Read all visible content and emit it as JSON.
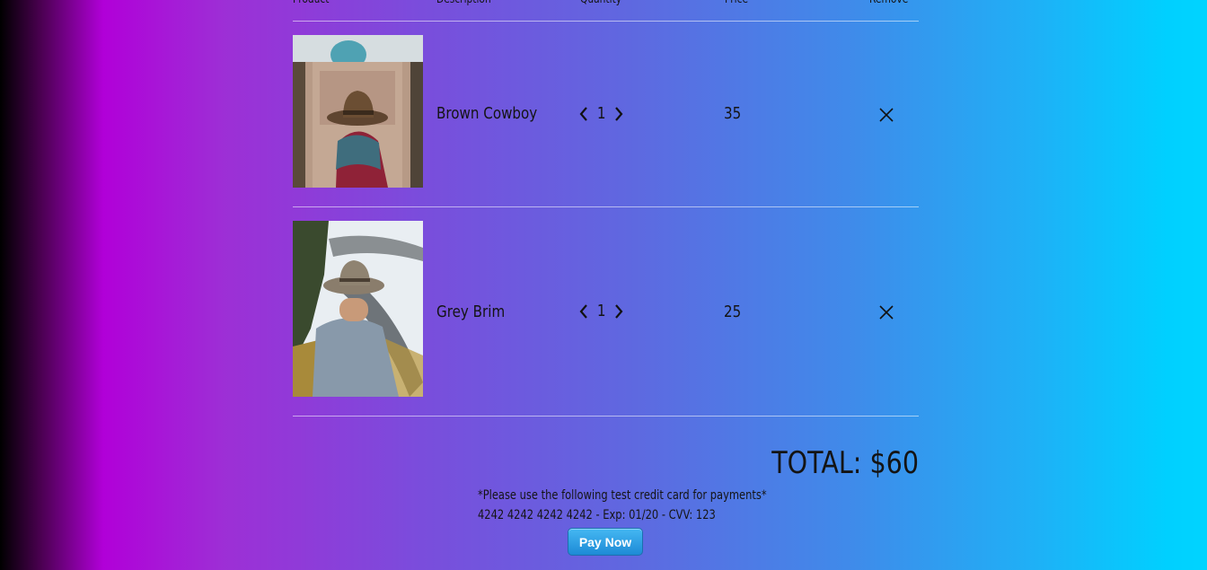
{
  "table": {
    "headers": {
      "product": "Product",
      "description": "Description",
      "quantity": "Quantity",
      "price": "Price",
      "remove": "Remove"
    }
  },
  "items": [
    {
      "image": "brown-cowboy-hat-photo",
      "description": "Brown Cowboy",
      "quantity": "1",
      "price": "35"
    },
    {
      "image": "grey-brim-hat-photo",
      "description": "Grey Brim",
      "quantity": "1",
      "price": "25"
    }
  ],
  "summary": {
    "total": "TOTAL: $60",
    "note_line1": "*Please use the following test credit card for payments*",
    "note_line2": "4242 4242 4242 4242 - Exp: 01/20 - CVV: 123"
  },
  "actions": {
    "pay_label": "Pay Now"
  },
  "colors": {
    "pay_button": "#1d8ad6",
    "gradient_left": "#000000",
    "gradient_mid": "#b100d8",
    "gradient_right": "#00d4ff"
  }
}
